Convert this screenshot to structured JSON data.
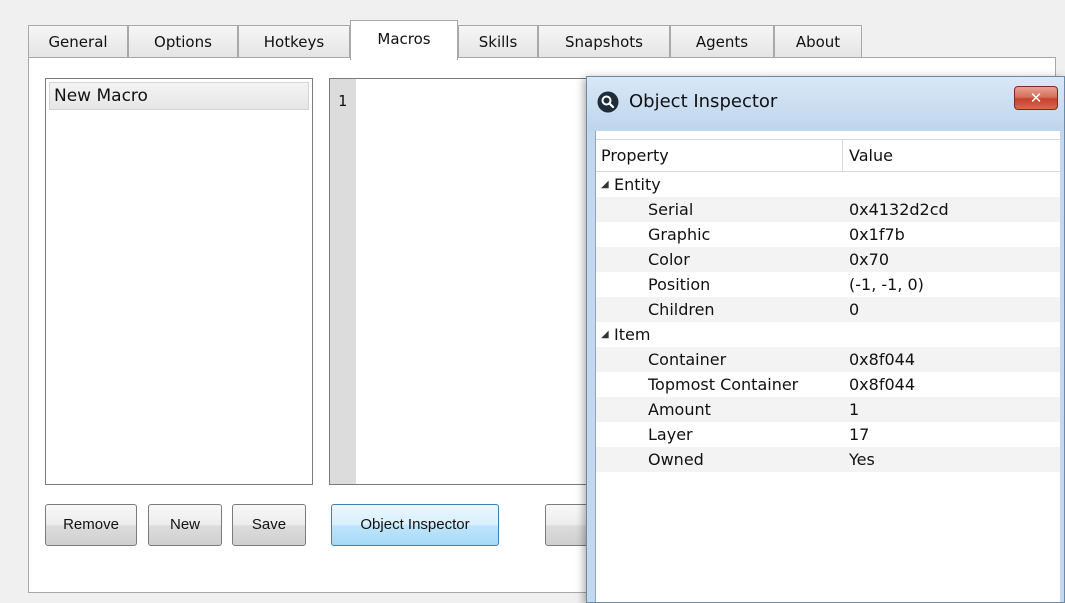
{
  "tabs": [
    {
      "label": "General",
      "active": false
    },
    {
      "label": "Options",
      "active": false
    },
    {
      "label": "Hotkeys",
      "active": false
    },
    {
      "label": "Macros",
      "active": true
    },
    {
      "label": "Skills",
      "active": false
    },
    {
      "label": "Snapshots",
      "active": false
    },
    {
      "label": "Agents",
      "active": false
    },
    {
      "label": "About",
      "active": false
    }
  ],
  "macros": {
    "items": [
      "New Macro"
    ],
    "editor_line": "1",
    "buttons": {
      "remove": "Remove",
      "new": "New",
      "save": "Save",
      "object_inspector": "Object Inspector"
    }
  },
  "inspector": {
    "title": "Object Inspector",
    "close_glyph": "✕",
    "icon": "magnifier-icon",
    "headers": {
      "property": "Property",
      "value": "Value"
    },
    "groups": [
      {
        "name": "Entity",
        "rows": [
          {
            "property": "Serial",
            "value": "0x4132d2cd"
          },
          {
            "property": "Graphic",
            "value": "0x1f7b"
          },
          {
            "property": "Color",
            "value": "0x70"
          },
          {
            "property": "Position",
            "value": "(-1, -1, 0)"
          },
          {
            "property": "Children",
            "value": "0"
          }
        ]
      },
      {
        "name": "Item",
        "rows": [
          {
            "property": "Container",
            "value": "0x8f044"
          },
          {
            "property": "Topmost Container",
            "value": "0x8f044"
          },
          {
            "property": "Amount",
            "value": "1"
          },
          {
            "property": "Layer",
            "value": "17"
          },
          {
            "property": "Owned",
            "value": "Yes"
          }
        ]
      }
    ]
  },
  "colors": {
    "accent": "#3c7fb1",
    "close_red": "#c5432b",
    "window_frame": "#c2d8ee"
  }
}
